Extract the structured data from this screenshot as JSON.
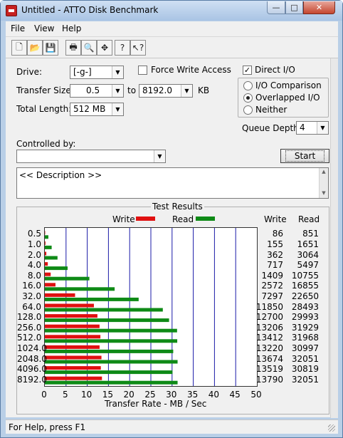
{
  "window": {
    "title": "Untitled - ATTO Disk Benchmark",
    "min": "—",
    "max": "□",
    "close": "✕"
  },
  "menu": [
    "File",
    "View",
    "Help"
  ],
  "toolbar": [
    {
      "name": "new-doc-icon",
      "glyph": "🗋"
    },
    {
      "name": "open-folder-icon",
      "glyph": "📂"
    },
    {
      "name": "save-icon",
      "glyph": "💾"
    },
    {
      "name": "print-icon",
      "glyph": "🖶"
    },
    {
      "name": "print-preview-icon",
      "glyph": "🔍"
    },
    {
      "name": "move-icon",
      "glyph": "✥"
    },
    {
      "name": "help-icon",
      "glyph": "?"
    },
    {
      "name": "context-help-icon",
      "glyph": "↖?"
    }
  ],
  "form": {
    "drive_label": "Drive:",
    "drive_value": "[-g-]",
    "transfer_label": "Transfer Size:",
    "transfer_from": "0.5",
    "to": "to",
    "transfer_to": "8192.0",
    "kb": "KB",
    "total_label": "Total Length:",
    "total_value": "512 MB",
    "force_write": "Force Write Access",
    "direct_io": "Direct I/O",
    "io_comparison": "I/O Comparison",
    "overlapped": "Overlapped I/O",
    "neither": "Neither",
    "queue_label": "Queue Depth:",
    "queue_value": "4",
    "controlled_label": "Controlled by:",
    "controlled_value": "",
    "start": "Start",
    "description": "<< Description >>"
  },
  "results_title": "Test Results",
  "legend": {
    "write": "Write",
    "read": "Read",
    "write_color": "#e01010",
    "read_color": "#0e8a16"
  },
  "columns": {
    "write": "Write",
    "read": "Read"
  },
  "status": "For Help, press F1",
  "chart_data": {
    "type": "bar",
    "orientation": "horizontal",
    "categories": [
      "0.5",
      "1.0",
      "2.0",
      "4.0",
      "8.0",
      "16.0",
      "32.0",
      "64.0",
      "128.0",
      "256.0",
      "512.0",
      "1024.0",
      "2048.0",
      "4096.0",
      "8192.0"
    ],
    "series": [
      {
        "name": "Write",
        "values": [
          0.08,
          0.15,
          0.35,
          0.7,
          1.38,
          2.51,
          7.13,
          11.57,
          12.4,
          12.9,
          13.1,
          12.91,
          13.35,
          13.2,
          13.47
        ]
      },
      {
        "name": "Read",
        "values": [
          0.83,
          1.61,
          2.99,
          5.37,
          10.5,
          16.46,
          22.12,
          27.82,
          29.29,
          31.18,
          31.22,
          30.27,
          31.3,
          30.1,
          31.3
        ]
      }
    ],
    "write_labels": [
      "86",
      "155",
      "362",
      "717",
      "1409",
      "2572",
      "7297",
      "11850",
      "12700",
      "13206",
      "13412",
      "13220",
      "13674",
      "13519",
      "13790"
    ],
    "read_labels": [
      "851",
      "1651",
      "3064",
      "5497",
      "10755",
      "16855",
      "22650",
      "28493",
      "29993",
      "31929",
      "31968",
      "30997",
      "32051",
      "30819",
      "32051"
    ],
    "xticks": [
      "0",
      "5",
      "10",
      "15",
      "20",
      "25",
      "30",
      "35",
      "40",
      "45",
      "50"
    ],
    "xlim": [
      0,
      50
    ],
    "xlabel": "Transfer Rate - MB / Sec",
    "grid": "vertical"
  }
}
